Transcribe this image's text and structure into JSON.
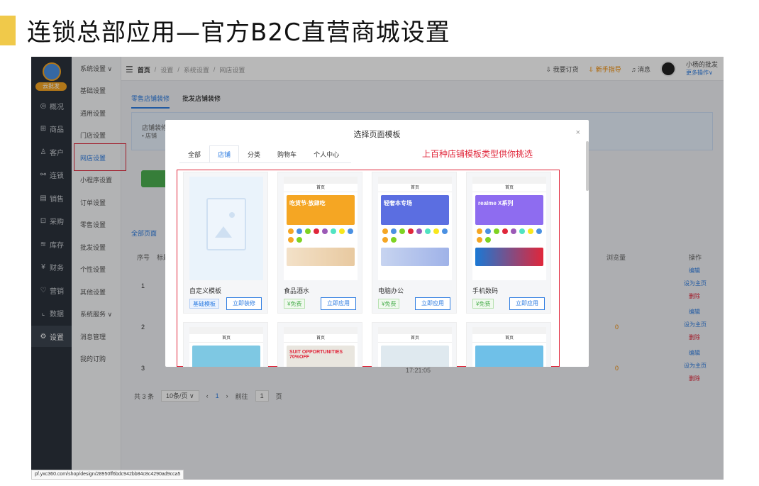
{
  "slide": {
    "title": "连锁总部应用—官方B2C直营商城设置"
  },
  "sidebar_dark": {
    "logo_tag": "云批发",
    "items": [
      {
        "label": "概况",
        "icon": "dashboard-icon",
        "glyph": "◎"
      },
      {
        "label": "商品",
        "icon": "grid-icon",
        "glyph": "⊞"
      },
      {
        "label": "客户",
        "icon": "user-icon",
        "glyph": "♙"
      },
      {
        "label": "连锁",
        "icon": "link-icon",
        "glyph": "⚯"
      },
      {
        "label": "销售",
        "icon": "document-icon",
        "glyph": "▤"
      },
      {
        "label": "采购",
        "icon": "purchase-icon",
        "glyph": "⊡"
      },
      {
        "label": "库存",
        "icon": "stack-icon",
        "glyph": "≋"
      },
      {
        "label": "财务",
        "icon": "money-icon",
        "glyph": "¥"
      },
      {
        "label": "营销",
        "icon": "gift-icon",
        "glyph": "♡"
      },
      {
        "label": "数据",
        "icon": "chart-icon",
        "glyph": "⌞"
      },
      {
        "label": "设置",
        "icon": "gear-icon",
        "glyph": "⚙"
      }
    ]
  },
  "sidebar_light": {
    "items": [
      "系统设置 ∨",
      "基础设置",
      "通用设置",
      "门店设置",
      "网店设置",
      "小程序设置",
      "订单设置",
      "零售设置",
      "批发设置",
      "个性设置",
      "其他设置",
      "系统服务 ∨",
      "消息管理",
      "我的订购"
    ]
  },
  "topbar": {
    "crumbs": [
      "首页",
      "设置",
      "系统设置",
      "网店设置"
    ],
    "order": "我要订货",
    "guide": "新手指导",
    "msg": "消息",
    "user_name": "小杨的批发",
    "more": "更多操作∨"
  },
  "content": {
    "tabs": [
      "零售店铺装修",
      "批发店铺装修"
    ],
    "info_line1": "店铺装修",
    "info_line2": "• 店铺",
    "all_pages": "全部页面",
    "col_seq": "序号",
    "col_title": "标题",
    "col_views": "浏览量",
    "col_ops": "操作",
    "row_nums": [
      "1",
      "2",
      "3"
    ],
    "views": [
      "0",
      "0"
    ],
    "ops": [
      "编辑",
      "设为主页",
      "删除"
    ],
    "time": "17:21:05",
    "total": "共 3 条",
    "page_size": "10条/页 ∨",
    "goto": "前往",
    "page_num": "1",
    "page_unit": "页",
    "current_page": "1",
    "url": "pf.yxc360.com/shop/design/28950ff6bdc942bb84c8c4290ad9cca5"
  },
  "modal": {
    "title": "选择页面模板",
    "close": "×",
    "tabs": [
      "全部",
      "店铺",
      "分类",
      "购物车",
      "个人中心"
    ],
    "active_tab": 1,
    "annotation": "上百种店铺模板类型供你挑选",
    "cards": [
      {
        "name": "自定义模板",
        "tag": "基础模板",
        "btn": "立即装修",
        "tag_style": "blue"
      },
      {
        "name": "食品酒水",
        "tag": "¥免费",
        "btn": "立即应用",
        "tag_style": "green",
        "banner": "吃货节·放肆吃",
        "banner_color": "#f5a623"
      },
      {
        "name": "电脑办公",
        "tag": "¥免费",
        "btn": "立即应用",
        "tag_style": "green",
        "banner": "轻奢本专场",
        "banner_color": "#5b6ee1"
      },
      {
        "name": "手机数码",
        "tag": "¥免费",
        "btn": "立即应用",
        "tag_style": "green",
        "banner": "realme X系列",
        "banner_color": "#8e6cf0"
      }
    ],
    "phone_title": "首页",
    "second_row_banners": [
      "",
      "SUIT OPPORTUNITIES 70%OFF",
      "",
      ""
    ]
  }
}
